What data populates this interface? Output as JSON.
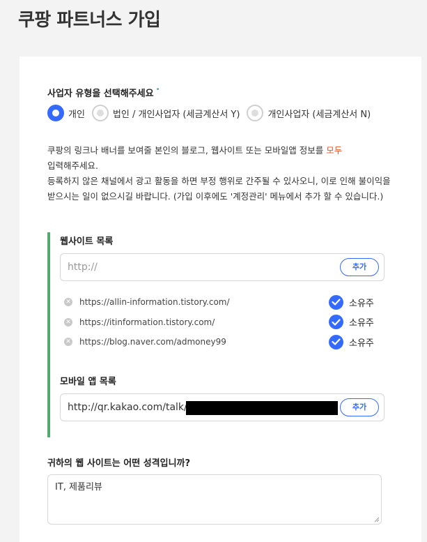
{
  "page": {
    "title": "쿠팡 파트너스 가입"
  },
  "business_type": {
    "question": "사업자 유형을 선택해주세요",
    "required_mark": "•",
    "options": [
      {
        "label": "개인",
        "selected": true
      },
      {
        "label": "법인 / 개인사업자 (세금계산서 Y)",
        "selected": false
      },
      {
        "label": "개인사업자 (세금계산서 N)",
        "selected": false
      }
    ]
  },
  "description": {
    "line1_prefix": "쿠팡의 링크나 배너를 보여줄 본인의 블로그, 웹사이트 또는 모바일앱 정보를 ",
    "line1_accent": "모두",
    "line2": "입력해주세요.",
    "line3": "등록하지 않은 채널에서 광고 활동을 하면 부정 행위로 간주될 수 있사오니, 이로 인해 불이익을 받으시는 일이 없으시길 바랍니다. (가입 이후에도 '계정관리' 메뉴에서 추가 할 수 있습니다.)"
  },
  "website": {
    "label": "웹사이트 목록",
    "input_placeholder": "http://",
    "add_button": "추가",
    "sites": [
      {
        "url": "https://allin-information.tistory.com/",
        "owner_label": "소유주"
      },
      {
        "url": "https://itinformation.tistory.com/",
        "owner_label": "소유주"
      },
      {
        "url": "https://blog.naver.com/admoney99",
        "owner_label": "소유주"
      }
    ]
  },
  "mobile_app": {
    "label": "모바일 앱 목록",
    "input_value": "http://qr.kakao.com/talk/",
    "add_button": "추가"
  },
  "site_nature": {
    "question": "귀하의 웹 사이트는 어떤 성격입니까?",
    "answer": "IT, 제품리뷰"
  },
  "colors": {
    "accent_blue": "#346aff",
    "section_bar_green": "#55a86f",
    "highlight_orange": "#e8562b"
  }
}
